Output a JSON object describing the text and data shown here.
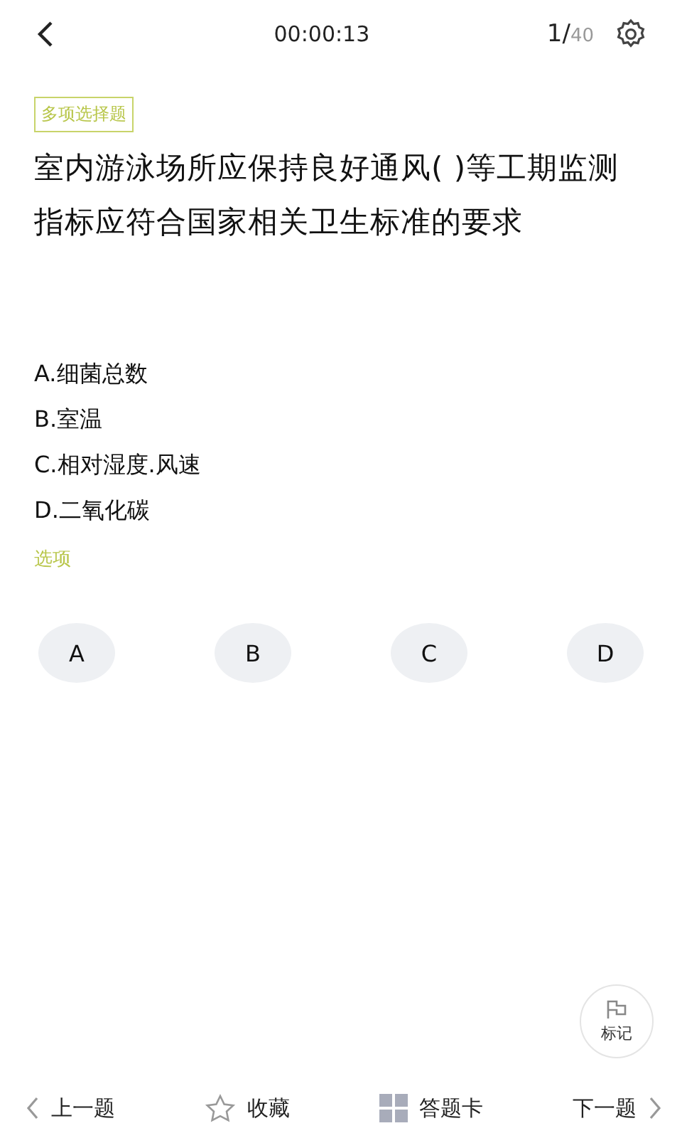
{
  "header": {
    "timer": "00:00:13",
    "progress_current": "1/",
    "progress_total": "40"
  },
  "question": {
    "type_tag": "多项选择题",
    "text": "室内游泳场所应保持良好通风( )等工期监测指标应符合国家相关卫生标准的要求",
    "options": [
      "A.细菌总数",
      "B.室温",
      "C.相对湿度.风速",
      "D.二氧化碳"
    ]
  },
  "answer_label": "选项",
  "choices": [
    {
      "label": "A",
      "selected": false
    },
    {
      "label": "B",
      "selected": false
    },
    {
      "label": "C",
      "selected": false
    },
    {
      "label": "D",
      "selected": false
    }
  ],
  "mark_button": {
    "label": "标记"
  },
  "bottom_bar": {
    "prev": "上一题",
    "favorite": "收藏",
    "answer_card": "答题卡",
    "next": "下一题"
  }
}
